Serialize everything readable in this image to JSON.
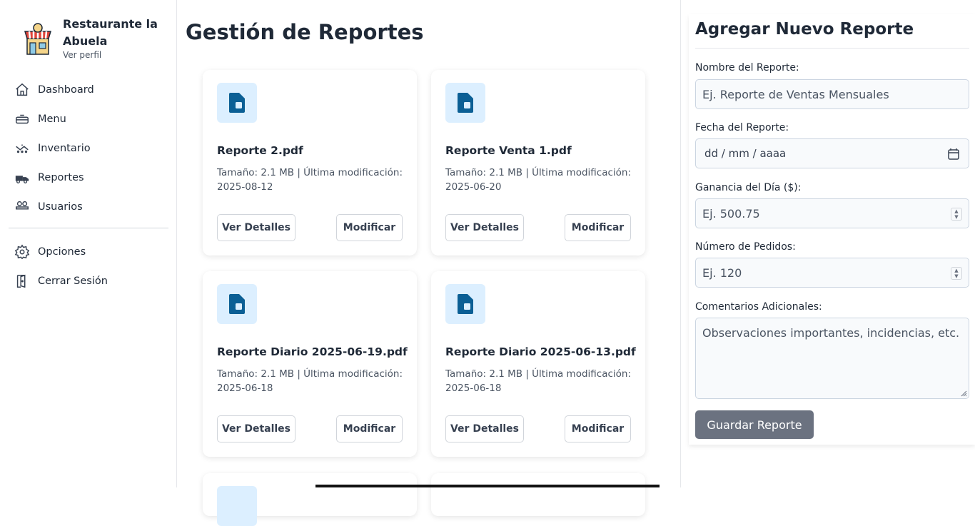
{
  "brand": {
    "name": "Restaurante la Abuela",
    "profile_link": "Ver perfil"
  },
  "sidebar": {
    "items": [
      {
        "label": "Dashboard",
        "icon": "home-icon"
      },
      {
        "label": "Menu",
        "icon": "serving-dish-icon"
      },
      {
        "label": "Inventario",
        "icon": "inventory-icon"
      },
      {
        "label": "Reportes",
        "icon": "truck-icon"
      },
      {
        "label": "Usuarios",
        "icon": "users-icon"
      }
    ],
    "bottom_items": [
      {
        "label": "Opciones",
        "icon": "gear-icon"
      },
      {
        "label": "Cerrar Sesión",
        "icon": "door-exit-icon"
      }
    ]
  },
  "main": {
    "title": "Gestión de Reportes",
    "reports": [
      {
        "name": "Reporte 2.pdf",
        "meta": "Tamaño: 2.1 MB | Última modificación: 2025-08-12"
      },
      {
        "name": "Reporte Venta 1.pdf",
        "meta": "Tamaño: 2.1 MB | Última modificación: 2025-06-20"
      },
      {
        "name": "Reporte Diario 2025-06-19.pdf",
        "meta": "Tamaño: 2.1 MB | Última modificación: 2025-06-18"
      },
      {
        "name": "Reporte Diario 2025-06-13.pdf",
        "meta": "Tamaño: 2.1 MB | Última modificación: 2025-06-18"
      }
    ],
    "details_label": "Ver Detalles",
    "modify_label": "Modificar"
  },
  "form": {
    "title": "Agregar Nuevo Reporte",
    "name_label": "Nombre del Reporte:",
    "name_placeholder": "Ej. Reporte de Ventas Mensuales",
    "date_label": "Fecha del Reporte:",
    "date_placeholder": "dd / mm / aaaa",
    "profit_label": "Ganancia del Día ($):",
    "profit_placeholder": "Ej. 500.75",
    "orders_label": "Número de Pedidos:",
    "orders_placeholder": "Ej. 120",
    "comments_label": "Comentarios Adicionales:",
    "comments_placeholder": "Observaciones importantes, incidencias, etc.",
    "save_label": "Guardar Reporte"
  },
  "colors": {
    "icon_bg": "#dcefff",
    "icon_fg": "#0b5f95",
    "save_button": "#6b7280"
  }
}
